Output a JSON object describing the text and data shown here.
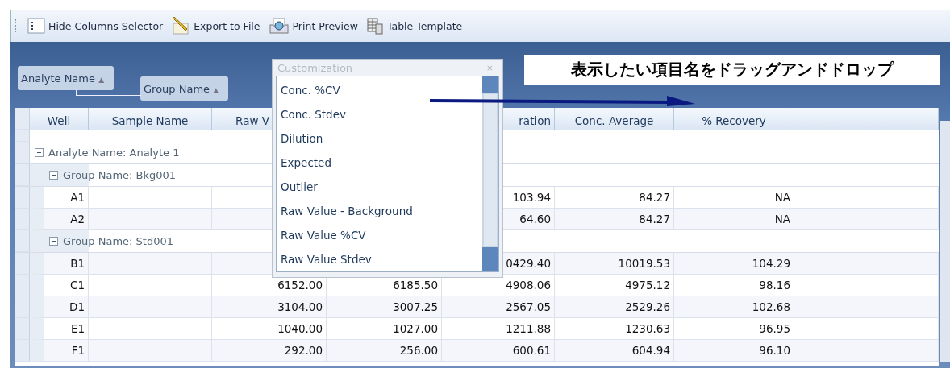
{
  "toolbar": {
    "buttons": [
      {
        "label": "Hide Columns Selector",
        "kind": "columns"
      },
      {
        "label": "Export to File",
        "kind": "export"
      },
      {
        "label": "Print Preview",
        "kind": "print"
      },
      {
        "label": "Table Template",
        "kind": "template"
      }
    ]
  },
  "banner": {
    "text": "表示したい項目名をドラッグアンドドロップ"
  },
  "group_panel": {
    "chips": [
      {
        "label": "Analyte Name",
        "sort_glyph": "▲"
      },
      {
        "label": "Group Name",
        "sort_glyph": "▲"
      }
    ]
  },
  "customization": {
    "title": "Customization",
    "close": "×",
    "items": [
      "Conc. %CV",
      "Conc. Stdev",
      "Dilution",
      "Expected",
      "Outlier",
      "Raw Value - Background",
      "Raw Value %CV",
      "Raw Value Stdev"
    ]
  },
  "table": {
    "columns": {
      "well": "Well",
      "sample_name": "Sample Name",
      "column_3": "Raw V",
      "column_5": "ration",
      "conc_average": "Conc. Average",
      "recovery": "% Recovery"
    },
    "rows": [
      {
        "kind": "analyte",
        "label": "Analyte Name: Analyte 1",
        "expanded": true
      },
      {
        "kind": "group",
        "label": "Group Name: Bkg001",
        "expanded": true
      },
      {
        "kind": "data",
        "well": "A1",
        "column_5": "103.94",
        "conc_average": "84.27",
        "recovery": "NA"
      },
      {
        "kind": "data",
        "well": "A2",
        "column_5": "64.60",
        "conc_average": "84.27",
        "recovery": "NA"
      },
      {
        "kind": "group",
        "label": "Group Name: Std001",
        "expanded": true
      },
      {
        "kind": "data",
        "well": "B1",
        "column_5": "0429.40",
        "conc_average": "10019.53",
        "recovery": "104.29"
      },
      {
        "kind": "data",
        "well": "C1",
        "column_3": "6152.00",
        "column_4": "6185.50",
        "column_5": "4908.06",
        "conc_average": "4975.12",
        "recovery": "98.16"
      },
      {
        "kind": "data",
        "well": "D1",
        "column_3": "3104.00",
        "column_4": "3007.25",
        "column_5": "2567.05",
        "conc_average": "2529.26",
        "recovery": "102.68"
      },
      {
        "kind": "data",
        "well": "E1",
        "column_3": "1040.00",
        "column_4": "1027.00",
        "column_5": "1211.88",
        "conc_average": "1230.63",
        "recovery": "96.95"
      },
      {
        "kind": "data",
        "well": "F1",
        "column_3": "292.00",
        "column_4": "256.00",
        "column_5": "600.61",
        "conc_average": "604.94",
        "recovery": "96.10"
      }
    ]
  }
}
